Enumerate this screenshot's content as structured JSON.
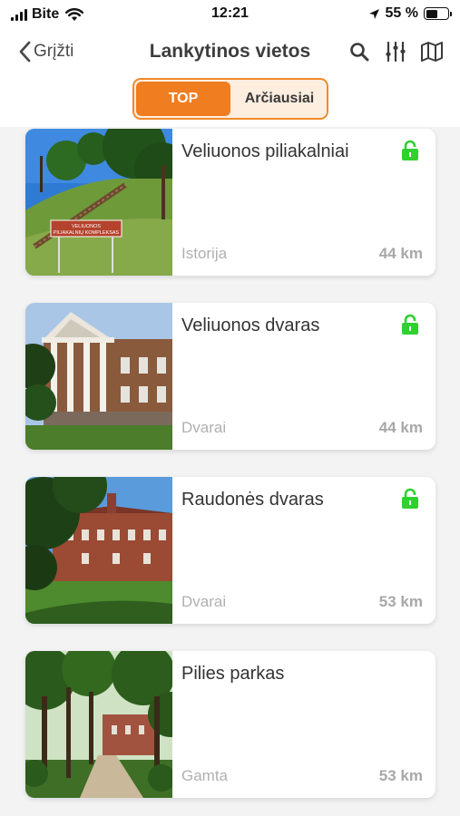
{
  "status_bar": {
    "carrier": "Bite",
    "time": "12:21",
    "battery": "55 %",
    "battery_level": 0.55
  },
  "nav": {
    "back_label": "Grįžti",
    "title": "Lankytinos vietos",
    "icons": [
      "search-icon",
      "filter-sliders-icon",
      "map-icon"
    ]
  },
  "segment": {
    "tabs": [
      {
        "label": "TOP",
        "active": true
      },
      {
        "label": "Arčiausiai",
        "active": false
      }
    ]
  },
  "colors": {
    "accent": "#f07d1f",
    "lock_green": "#2fd12f"
  },
  "places": [
    {
      "title": "Veliuonos piliakalniai",
      "category": "Istorija",
      "distance": "44 km",
      "unlocked": true,
      "image": "hill-fort-photo",
      "sign_text": [
        "VELIUONOS",
        "PILIAKALNIŲ KOMPLEKSAS"
      ]
    },
    {
      "title": "Veliuonos dvaras",
      "category": "Dvarai",
      "distance": "44 km",
      "unlocked": true,
      "image": "manor-columns-photo"
    },
    {
      "title": "Raudonės dvaras",
      "category": "Dvarai",
      "distance": "53 km",
      "unlocked": true,
      "image": "red-brick-manor-photo"
    },
    {
      "title": "Pilies parkas",
      "category": "Gamta",
      "distance": "53 km",
      "unlocked": false,
      "image": "park-trees-photo"
    }
  ]
}
